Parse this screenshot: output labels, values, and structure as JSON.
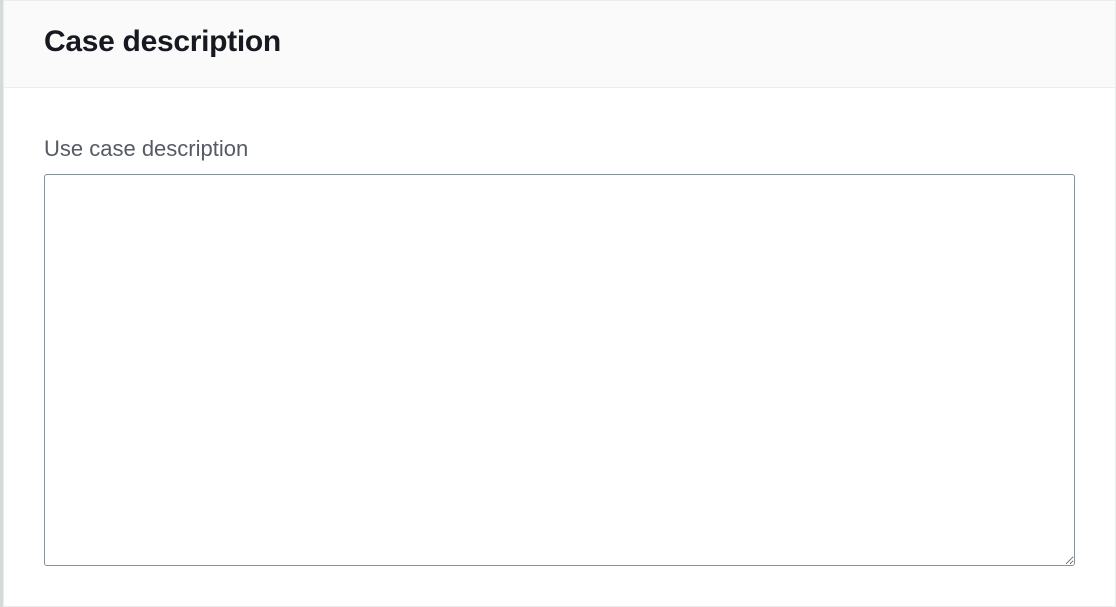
{
  "panel": {
    "title": "Case description"
  },
  "form": {
    "use_case": {
      "label": "Use case description",
      "value": ""
    }
  }
}
